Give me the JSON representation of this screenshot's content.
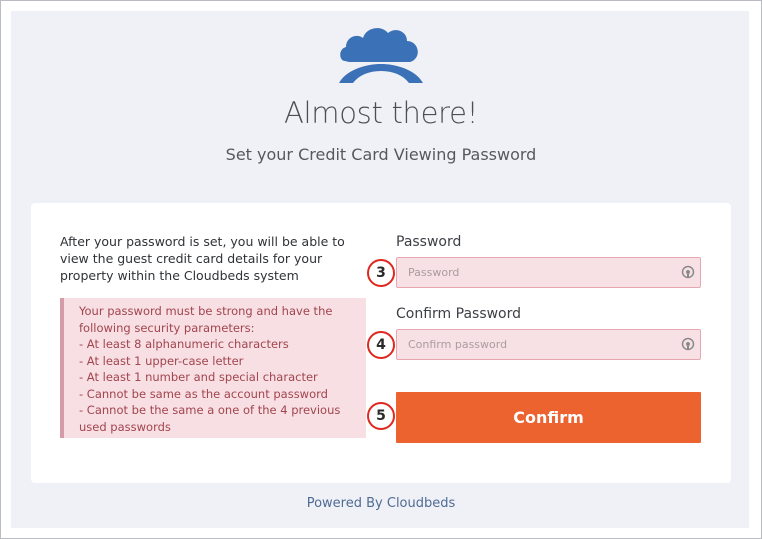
{
  "header": {
    "title": "Almost there!",
    "subtitle": "Set your Credit Card Viewing Password"
  },
  "intro_text": "After your password is set, you will be able to view the guest credit card details for your property within the Cloudbeds system",
  "rules": {
    "lines": [
      "Your password must be strong and have the",
      "following security parameters:",
      "- At least 8 alphanumeric characters",
      "- At least 1 upper-case letter",
      "- At least 1 number and special character",
      "- Cannot be same as the account password",
      "- Cannot be the same a one of the 4 previous",
      "used passwords"
    ]
  },
  "form": {
    "password_label": "Password",
    "password_placeholder": "Password",
    "password_value": "",
    "confirm_label": "Confirm Password",
    "confirm_placeholder": "Confirm password",
    "confirm_value": "",
    "confirm_button": "Confirm"
  },
  "callouts": [
    "3",
    "4",
    "5"
  ],
  "footer": {
    "powered_by": "Powered By Cloudbeds"
  },
  "icons": {
    "logo": "cloudbeds-logo-icon",
    "password_toggle": "eye-toggle-icon"
  },
  "colors": {
    "brand_blue": "#3a71b7",
    "confirm_orange": "#ec6330",
    "error_pink": "#f7dfe3",
    "callout_red": "#e0281f"
  }
}
